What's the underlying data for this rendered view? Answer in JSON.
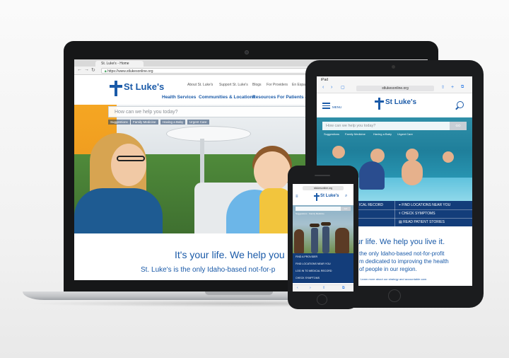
{
  "laptop": {
    "tab_title": "St. Luke's - Home",
    "url": "https://www.stlukesonline.org",
    "utility_links": [
      "About St. Luke's",
      "Support St. Luke's",
      "Blogs",
      "For Providers",
      "En Español"
    ],
    "main_nav": [
      "Health Services",
      "Communities & Locations",
      "Resources For Patients & Vis"
    ],
    "logo_text": "St Luke's",
    "search_placeholder": "How can we help you today?",
    "suggestions": [
      "Suggestions",
      "Family Medicine",
      "Having a Baby",
      "Urgent Care"
    ],
    "tagline": "It's your life. We help you",
    "subline": "St. Luke's is the only Idaho-based not-for-p"
  },
  "tablet": {
    "status": "iPad",
    "url": "stlukesonline.org",
    "menu_label": "MENU",
    "logo_text": "St Luke's",
    "search_placeholder": "How can we help you today?",
    "search_button": "GO",
    "suggestions": [
      "Suggestions",
      "Family Medicine",
      "Having a Baby",
      "Urgent Care"
    ],
    "links": {
      "find_locations": "FIND LOCATIONS NEAR YOU",
      "check_symptoms": "CHECK SYMPTOMS",
      "read_stories": "READ PATIENT STORIES",
      "medical_record": "ICAL RECORD"
    },
    "tagline": "ur life. We help you live it.",
    "body_lines": [
      "the only Idaho-based not-for-profit",
      "m dedicated to improving the health",
      "of people in our region."
    ],
    "learn_more": "Learn more about our strategy and accountable care."
  },
  "phone": {
    "url": "stlukesonline.org",
    "logo_text": "St Luke's",
    "search_button": "GO",
    "suggestions": "Suggestions · Family Medicine",
    "links": [
      "FIND A PROVIDER",
      "FIND LOCATIONS NEAR YOU",
      "LOG IN TO MEDICAL RECORD",
      "CHECK SYMPTOMS"
    ],
    "toolbar": [
      "‹",
      "›",
      "⇧",
      "⧉"
    ]
  },
  "colors": {
    "brand_blue": "#1a5aa8",
    "nav_navy": "#133d7a",
    "accent_orange": "#f5a623"
  }
}
